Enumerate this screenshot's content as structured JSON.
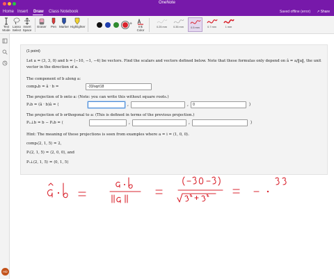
{
  "app": {
    "title": "OneNote",
    "status": "Saved offline (error)",
    "share": "Share"
  },
  "tabs": [
    {
      "label": "Home",
      "active": false
    },
    {
      "label": "Insert",
      "active": false
    },
    {
      "label": "Draw",
      "active": true
    },
    {
      "label": "Class Notebook",
      "active": false
    }
  ],
  "toolbar": {
    "text_mode": "Text Mode",
    "lasso": "Lasso Select",
    "insert_space": "Insert Space",
    "eraser": "Eraser",
    "pen": "Pen",
    "marker": "Marker",
    "highlighter": "Highlighter",
    "ink_to_color": "Ink Color",
    "colors": [
      "#111111",
      "#1f3fae",
      "#2e8b2e",
      "#d9232d"
    ],
    "thickness": [
      {
        "label": "0.25 mm",
        "selected": false
      },
      {
        "label": "0.35 mm",
        "selected": false
      },
      {
        "label": "0.5 mm",
        "selected": true
      },
      {
        "label": "0.7 mm",
        "selected": false
      },
      {
        "label": "1 mm",
        "selected": false
      }
    ]
  },
  "user": {
    "initials": "HD"
  },
  "problem": {
    "points": "(1 point)",
    "intro1": "Let a = ⟨3, 3, 0⟩ and b = ⟨−10, −1, −4⟩ be vectors. Find the scalars and vectors defined below. Note that these formulas only depend on â = a/‖a‖, the unit",
    "intro2": "vector in the direction of a.",
    "comp_label": "The component of b along a:",
    "comp_formula": "compₐb = â · b =",
    "comp_value": "-33/sqrt18",
    "proj_label": "The projection of b onto a: (Note: you can write this without square roots.)",
    "proj_formula": "Pₐb = (â · b)â = ⟨",
    "proj_values": [
      "",
      "",
      "0"
    ],
    "perp_label": "The projection of b orthogonal to a: (This is defined in terms of the previous projection.)",
    "perp_formula": "Pₐ⊥b = b − Pₐb = ⟨",
    "perp_values": [
      "",
      "",
      ""
    ],
    "hint": "Hint: The meaning of these projections is seen from examples where a = i = ⟨1, 0, 0⟩.",
    "ex1": "compᵢ⟨2, 1, 5⟩ = 2,",
    "ex2": "Pᵢ⟨2, 1, 5⟩ = ⟨2, 0, 0⟩, and",
    "ex3": "Pᵢ⊥⟨2, 1, 5⟩ = ⟨0, 1, 5⟩"
  }
}
